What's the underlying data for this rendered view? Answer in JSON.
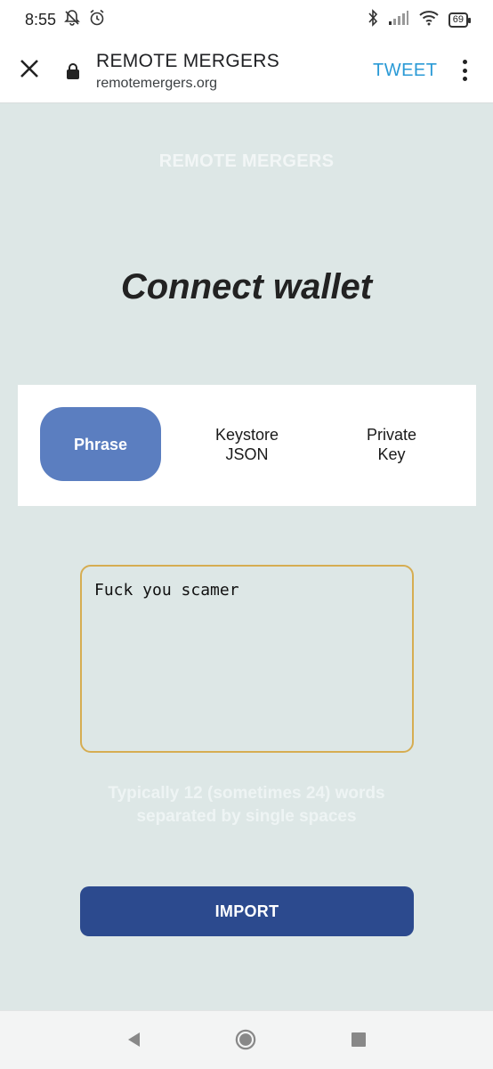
{
  "status_bar": {
    "time": "8:55",
    "battery": "69",
    "icons": [
      "bell-off-icon",
      "alarm-icon",
      "bluetooth-icon",
      "signal-icon",
      "wifi-icon",
      "battery-icon"
    ]
  },
  "browser": {
    "page_title": "REMOTE MERGERS",
    "url": "remotemergers.org",
    "action_label": "TWEET",
    "icons": [
      "close-icon",
      "lock-icon",
      "more-vert-icon"
    ]
  },
  "page": {
    "brand": "REMOTE MERGERS",
    "heading": "Connect wallet",
    "tabs": [
      {
        "label": "Phrase",
        "active": true
      },
      {
        "label": "Keystore\nJSON",
        "active": false
      },
      {
        "label": "Private\nKey",
        "active": false
      }
    ],
    "phrase_value": "Fuck you scamer",
    "hint": "Typically 12 (sometimes 24) words\nseparated by single spaces",
    "import_label": "IMPORT"
  },
  "nav": {
    "icons": [
      "back-icon",
      "home-icon",
      "recents-icon"
    ]
  },
  "colors": {
    "page_bg": "#dde7e6",
    "active_tab": "#5b7ec0",
    "import_button": "#2c4a8e",
    "input_border": "#d6ad52",
    "tweet_link": "#2a9ad6"
  }
}
